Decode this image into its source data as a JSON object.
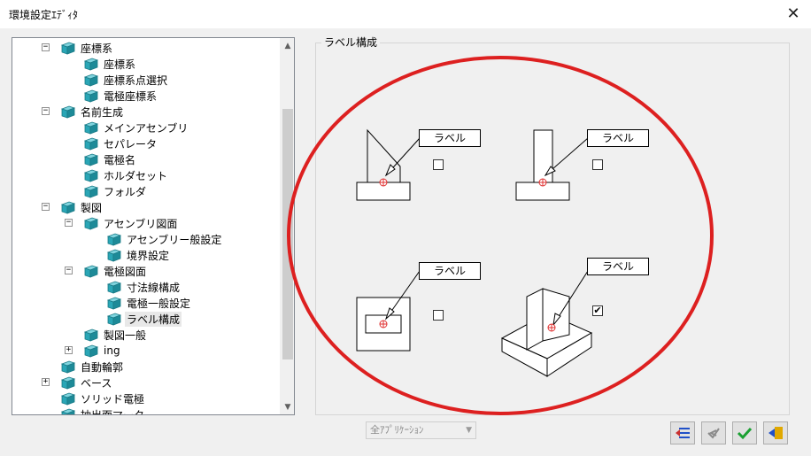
{
  "window": {
    "title": "環境設定ｴﾃﾞｨﾀ",
    "close_glyph": "✕"
  },
  "tree": {
    "items": [
      {
        "label": "座標系",
        "level": 1,
        "expander": "−"
      },
      {
        "label": "座標系",
        "level": 2
      },
      {
        "label": "座標系点選択",
        "level": 2
      },
      {
        "label": "電極座標系",
        "level": 2
      },
      {
        "label": "名前生成",
        "level": 1,
        "expander": "−"
      },
      {
        "label": "メインアセンブリ",
        "level": 2
      },
      {
        "label": "セパレータ",
        "level": 2
      },
      {
        "label": "電極名",
        "level": 2
      },
      {
        "label": "ホルダセット",
        "level": 2
      },
      {
        "label": "フォルダ",
        "level": 2
      },
      {
        "label": "製図",
        "level": 1,
        "expander": "−"
      },
      {
        "label": "アセンブリ図面",
        "level": 2,
        "expander": "−"
      },
      {
        "label": "アセンブリー般設定",
        "level": 3
      },
      {
        "label": "境界設定",
        "level": 3
      },
      {
        "label": "電極図面",
        "level": 2,
        "expander": "−"
      },
      {
        "label": "寸法線構成",
        "level": 3
      },
      {
        "label": "電極一般設定",
        "level": 3
      },
      {
        "label": "ラベル構成",
        "level": 3,
        "selected": true
      },
      {
        "label": "製図一般",
        "level": 2
      },
      {
        "label": "ing",
        "level": 2,
        "expander": "+"
      },
      {
        "label": "自動輪郭",
        "level": 1
      },
      {
        "label": "ベース",
        "level": 1,
        "expander": "+"
      },
      {
        "label": "ソリッド電極",
        "level": 1
      },
      {
        "label": "抽出面マーク",
        "level": 1
      }
    ],
    "scroll_up_glyph": "▲",
    "scroll_down_glyph": "▼"
  },
  "group": {
    "title": "ラベル構成"
  },
  "label_options": [
    {
      "label": "ラベル",
      "checked": false
    },
    {
      "label": "ラベル",
      "checked": false
    },
    {
      "label": "ラベル",
      "checked": false
    },
    {
      "label": "ラベル",
      "checked": true
    }
  ],
  "check_glyph": "✔",
  "bottom": {
    "dropdown_value": "全ｱﾌﾟﾘｹｰｼｮﾝ",
    "dropdown_arrow": "▼"
  },
  "colors": {
    "highlight_ellipse": "#dd2020",
    "node_icon": "#2aa6b6",
    "marker_red": "#e03030",
    "ok_green": "#1aa032",
    "icon_blue": "#2050c8",
    "icon_yellow": "#e0a800"
  },
  "icons": {
    "node": "cube-icon",
    "btn1": "list-arrow-icon",
    "btn2": "undo-check-icon",
    "btn3": "ok-check-icon",
    "btn4": "exit-icon"
  }
}
